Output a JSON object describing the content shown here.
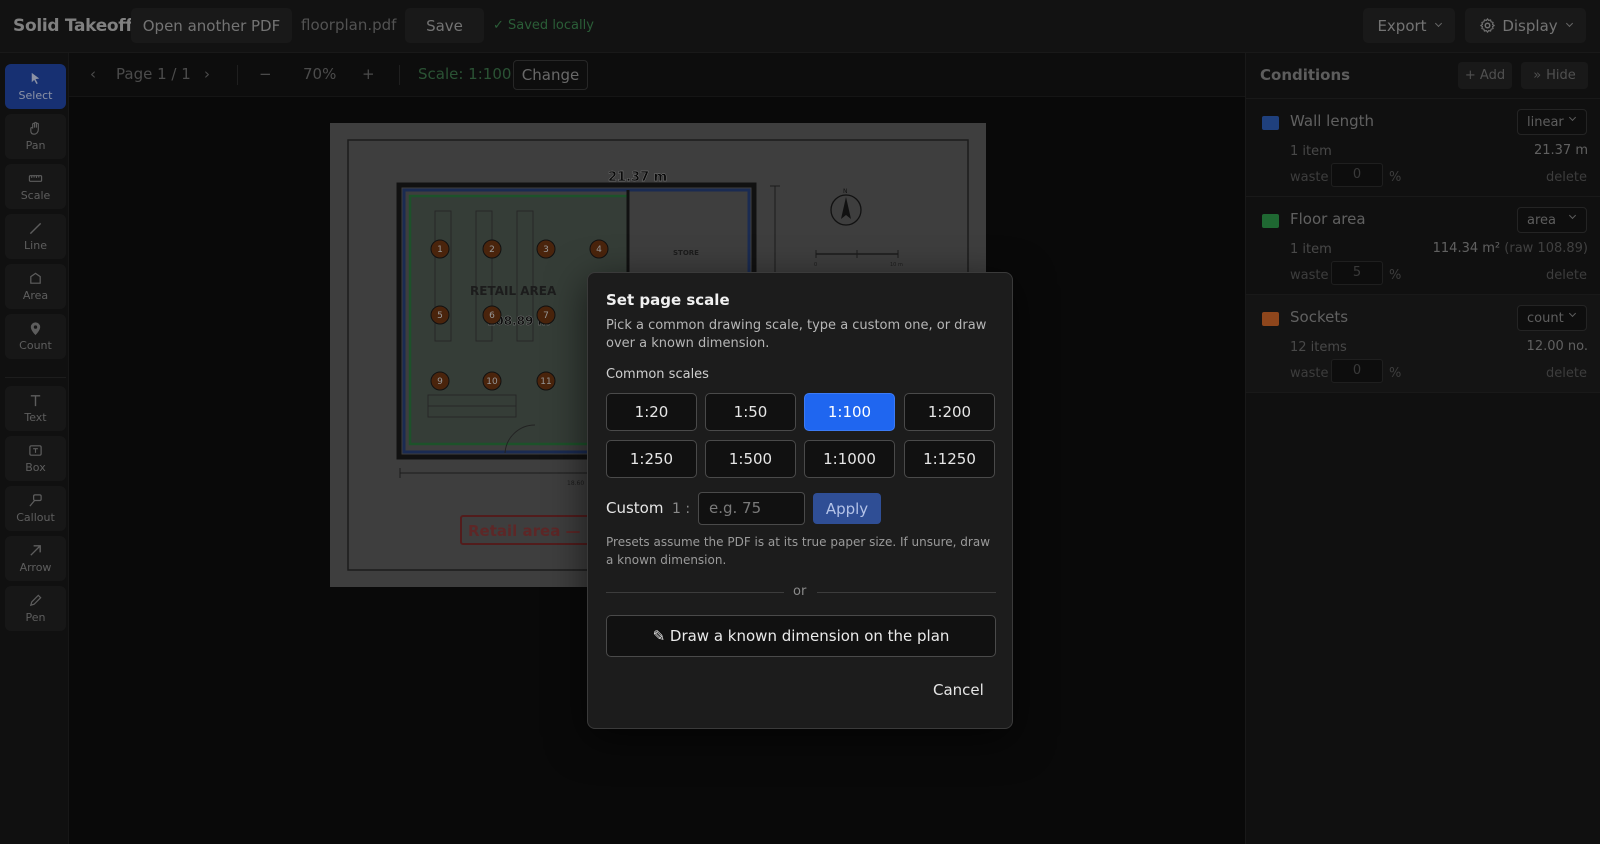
{
  "topbar": {
    "brand": "Solid Takeoff",
    "open_label": "Open another PDF",
    "filename": "floorplan.pdf",
    "save_label": "Save",
    "saved_status": "✓ Saved locally",
    "export_label": "Export",
    "display_label": "Display"
  },
  "tools": [
    {
      "label": "Select",
      "icon": "cursor-icon"
    },
    {
      "label": "Pan",
      "icon": "hand-icon"
    },
    {
      "label": "Scale",
      "icon": "ruler-icon"
    },
    {
      "label": "Line",
      "icon": "line-icon"
    },
    {
      "label": "Area",
      "icon": "polygon-icon"
    },
    {
      "label": "Count",
      "icon": "pin-icon"
    },
    {
      "label": "Text",
      "icon": "text-icon"
    },
    {
      "label": "Box",
      "icon": "box-icon"
    },
    {
      "label": "Callout",
      "icon": "callout-icon"
    },
    {
      "label": "Arrow",
      "icon": "arrow-icon"
    },
    {
      "label": "Pen",
      "icon": "pen-icon"
    }
  ],
  "subbar": {
    "prev": "‹",
    "page": "Page 1 / 1",
    "next": "›",
    "zoom_out": "−",
    "zoom": "70%",
    "zoom_in": "+",
    "scale": "Scale: 1:100",
    "change_label": "Change"
  },
  "plan": {
    "dimension_top": "21.37 m",
    "area_title": "RETAIL AREA",
    "area_value": "108.89 m",
    "store_label": "STORE",
    "bottom_dim": "18.60",
    "legend_text": "Retail area —",
    "scale_bar_start": "0",
    "scale_bar_end": "10 m",
    "north": "N",
    "markers": [
      "1",
      "2",
      "3",
      "4",
      "5",
      "6",
      "7",
      "9",
      "10",
      "11"
    ]
  },
  "conditions": {
    "title": "Conditions",
    "add_label": "+ Add",
    "hide_label": "Hide",
    "items": [
      {
        "name": "Wall length",
        "type": "linear",
        "count": "1 item",
        "total": "21.37 m",
        "raw": "",
        "waste": "0",
        "color": "#2f5fb8"
      },
      {
        "name": "Floor area",
        "type": "area",
        "count": "1 item",
        "total": "114.34 m²",
        "raw": "(raw 108.89)",
        "waste": "5",
        "color": "#2e9a4a"
      },
      {
        "name": "Sockets",
        "type": "count",
        "count": "12 items",
        "total": "12.00 no.",
        "raw": "",
        "waste": "0",
        "color": "#d1682a"
      }
    ],
    "waste_label": "waste",
    "pct": "%",
    "delete_label": "delete"
  },
  "modal": {
    "title": "Set page scale",
    "description": "Pick a common drawing scale, type a custom one, or draw over a known dimension.",
    "common_label": "Common scales",
    "scales": [
      "1:20",
      "1:50",
      "1:100",
      "1:200",
      "1:250",
      "1:500",
      "1:1000",
      "1:1250"
    ],
    "selected_scale": "1:100",
    "custom_label": "Custom",
    "custom_prefix": "1 :",
    "custom_placeholder": "e.g. 75",
    "apply_label": "Apply",
    "hint": "Presets assume the PDF is at its true paper size. If unsure, draw a known dimension.",
    "or": "or",
    "draw_label": "✎ Draw a known dimension on the plan",
    "cancel_label": "Cancel"
  }
}
